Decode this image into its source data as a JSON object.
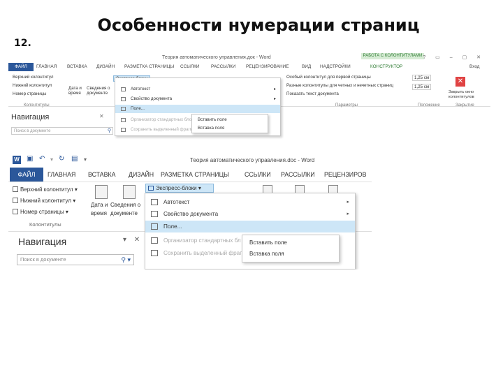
{
  "slide": {
    "number": "12.",
    "title": "Особенности нумерации страниц"
  },
  "small_shot": {
    "window_title": "Теория автоматического управления.док - Word",
    "context_tab": "РАБОТА С КОЛОНТИТУЛАМИ",
    "window_buttons": "? ▭ – ▢ ✕",
    "file_tab": "ФАЙЛ",
    "tabs": [
      "ГЛАВНАЯ",
      "ВСТАВКА",
      "ДИЗАЙН",
      "РАЗМЕТКА СТРАНИЦЫ",
      "ССЫЛКИ",
      "РАССЫЛКИ",
      "РЕЦЕНЗИРОВАНИЕ",
      "ВИД",
      "НАДСТРОЙКИ",
      "КОНСТРУКТОР"
    ],
    "user": "Вход",
    "ribbon": {
      "header": "Верхний колонтитул",
      "footer": "Нижний колонтитул",
      "page_number": "Номер страницы",
      "group_headers": "Колонтитулы",
      "date_time": "Дата и время",
      "doc_info": "Сведения о документе",
      "quick_parts": "Экспресс-блоки",
      "opt1": "Особый колонтитул для первой страницы",
      "opt2": "Разные колонтитулы для четных и нечетных страниц",
      "opt3": "Показать текст документа",
      "group_params": "Параметры",
      "pos1": "1,25 см",
      "pos2": "1,25 см",
      "group_position": "Положение",
      "close_label": "Закрыть окно колонтитулов",
      "group_close": "Закрытие"
    },
    "nav_title": "Навигация",
    "nav_close": "✕",
    "search_placeholder": "Поиск в документе",
    "menu": [
      "Автотекст",
      "Свойство документа",
      "Поле...",
      "Организатор стандартных блоков...",
      "Сохранить выделенный фрагмент в коллекцию экспресс-блоков..."
    ],
    "submenu": [
      "Вставить поле",
      "Вставка поля"
    ]
  },
  "big_shot": {
    "window_title": "Теория автоматического управления.doc - Word",
    "file_tab": "ФАЙЛ",
    "tabs": [
      "ГЛАВНАЯ",
      "ВСТАВКА",
      "ДИЗАЙН",
      "РАЗМЕТКА СТРАНИЦЫ",
      "ССЫЛКИ",
      "РАССЫЛКИ",
      "РЕЦЕНЗИРОВ"
    ],
    "ribbon": {
      "header": "Верхний колонтитул",
      "footer": "Нижний колонтитул",
      "page_number": "Номер страницы",
      "date_time_1": "Дата и",
      "date_time_2": "время",
      "doc_info_1": "Сведения о",
      "doc_info_2": "документе",
      "group_headers": "Колонтитулы",
      "quick_parts": "Экспресс-блоки"
    },
    "nav_title": "Навигация",
    "nav_buttons": "▾ ✕",
    "search_placeholder": "Поиск в документе",
    "menu": [
      "Автотекст",
      "Свойство документа",
      "Поле...",
      "Организатор стандартных бл",
      "Сохранить выделенный фраг"
    ],
    "submenu": [
      "Вставить поле",
      "Вставка поля"
    ]
  }
}
